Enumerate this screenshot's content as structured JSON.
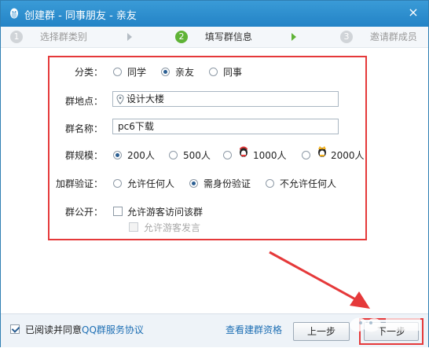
{
  "window": {
    "title": "创建群 - 同事朋友 - 亲友",
    "close_glyph": "×"
  },
  "steps": [
    {
      "num": "1",
      "label": "选择群类别",
      "active": false
    },
    {
      "num": "2",
      "label": "填写群信息",
      "active": true
    },
    {
      "num": "3",
      "label": "邀请群成员",
      "active": false
    }
  ],
  "form": {
    "category": {
      "label": "分类：",
      "options": [
        {
          "label": "同学",
          "checked": false
        },
        {
          "label": "亲友",
          "checked": true
        },
        {
          "label": "同事",
          "checked": false
        }
      ]
    },
    "location": {
      "label": "群地点：",
      "value": "设计大楼"
    },
    "name": {
      "label": "群名称：",
      "value": "pc6下载"
    },
    "size": {
      "label": "群规模：",
      "options": [
        {
          "label": "200人",
          "checked": true
        },
        {
          "label": "500人",
          "checked": false
        },
        {
          "label": "1000人",
          "checked": false
        },
        {
          "label": "2000人",
          "checked": false
        }
      ]
    },
    "verify": {
      "label": "加群验证：",
      "options": [
        {
          "label": "允许任何人",
          "checked": false
        },
        {
          "label": "需身份验证",
          "checked": true
        },
        {
          "label": "不允许任何人",
          "checked": false
        }
      ]
    },
    "public": {
      "label": "群公开：",
      "guest_visit": {
        "label": "允许游客访问该群",
        "checked": false
      },
      "guest_speak": {
        "label": "允许游客发言",
        "checked": false,
        "disabled": true
      }
    }
  },
  "footer": {
    "agree_prefix": "已阅读并同意",
    "agree_link": "QQ群服务协议",
    "agree_checked": true,
    "qualification_link": "查看建群资格",
    "prev_button": "上一步",
    "next_button": "下一步"
  },
  "colors": {
    "titlebar": "#2383c6",
    "highlight_red": "#e5393a",
    "step_active": "#5fb336",
    "link": "#1e6fb4"
  }
}
